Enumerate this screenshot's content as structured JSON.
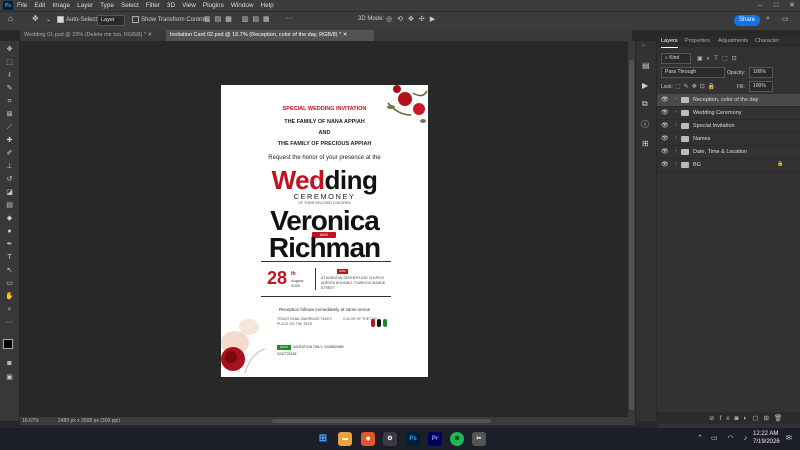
{
  "menubar": {
    "logo": "Ps",
    "items": [
      "File",
      "Edit",
      "Image",
      "Layer",
      "Type",
      "Select",
      "Filter",
      "3D",
      "View",
      "Plugins",
      "Window",
      "Help"
    ]
  },
  "options": {
    "auto_select_label": "Auto-Select:",
    "auto_select_value": "Layer",
    "show_transform_label": "Show Transform Controls",
    "mode_3d_label": "3D Mode:",
    "share_label": "Share"
  },
  "tabs": [
    {
      "label": "Wedding 01.psd @ 25% (Delete me too, RGB/8) *",
      "active": false
    },
    {
      "label": "Invitation Card 02.psd @ 16.7% (Reception, color of the day, RGB/8) *",
      "active": true
    }
  ],
  "status": {
    "zoom": "16.67%",
    "doc_size": "2480 px x 3508 px (300 ppi)"
  },
  "panel": {
    "tabs": [
      "Layers",
      "Properties",
      "Adjustments",
      "Character"
    ],
    "filter_kind": "Kind",
    "blend_mode": "Pass Through",
    "opacity_label": "Opacity:",
    "opacity_value": "100%",
    "lock_label": "Lock:",
    "fill_label": "Fill:",
    "fill_value": "100%",
    "layers": [
      {
        "name": "Reception, color of the day",
        "selected": true
      },
      {
        "name": "Wedding Ceremony",
        "selected": false
      },
      {
        "name": "Special Invitation",
        "selected": false
      },
      {
        "name": "Names",
        "selected": false
      },
      {
        "name": "Date, Time & Location",
        "selected": false
      },
      {
        "name": "BG",
        "selected": false
      }
    ]
  },
  "document": {
    "special": "SPECIAL WEDDING INVITATION",
    "family1": "THE FAMILY OF NANA APPIAH",
    "and": "AND",
    "family2": "THE FAMILY OF PRECIOUS APPIAH",
    "request": "Request the honor of your presence at the",
    "wedding_red": "Wed",
    "wedding_dark": "ding",
    "ceremony": "CEREMONEY",
    "of_their": "OF THEIR BELOVED CHILDREN",
    "name1": "Veronica",
    "and_badge": "AND",
    "name2": "Richman",
    "day": "28",
    "day_suffix": "th",
    "month": "August",
    "year": "2026",
    "at_badge": "8AM",
    "venue": "AT ADENTAN SEVENTH-DAY CHURCH ADENTA HOUSING, TOWN EXCHANGE STREET",
    "reception": "Reception follows immediately at same venue",
    "note_left": "TRADITIONAL MARRIAGE TAKES PLACE ON THE 25TH",
    "note_right": "COLOR OF THE DAY",
    "rsvp_badge": "RSVP",
    "rsvp_text": "INVITATION ONLY: 0245654989",
    "phone": "0247729152"
  },
  "taskbar": {
    "time": "12:22 AM",
    "date": "7/19/2026"
  },
  "colors": {
    "accent_red": "#c1121f",
    "share_blue": "#1473e6",
    "ps_blue": "#31a8ff"
  }
}
